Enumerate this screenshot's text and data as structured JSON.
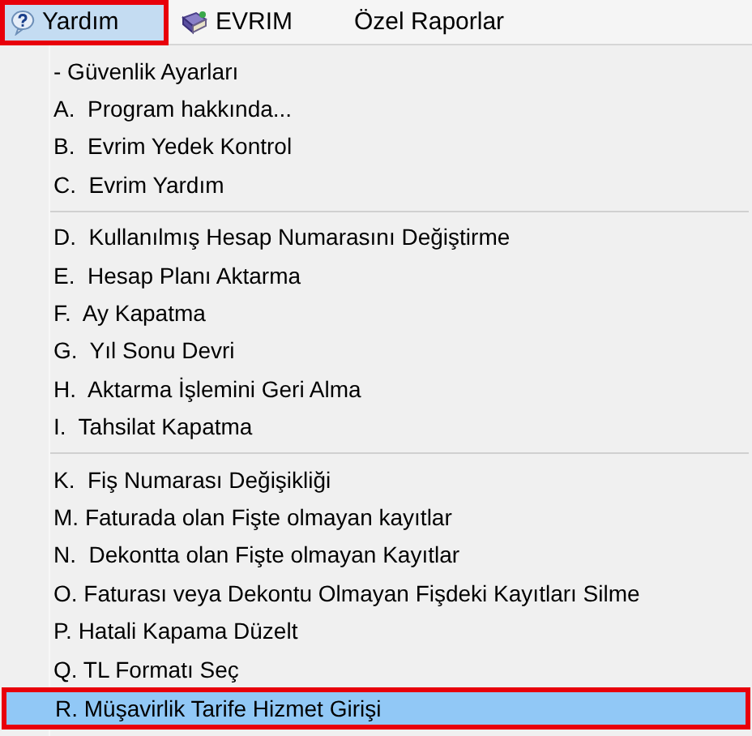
{
  "menu_bar": [
    {
      "label": "Yardım",
      "kind": "help",
      "selected": true
    },
    {
      "label": "EVRIM",
      "kind": "book",
      "selected": false
    },
    {
      "label": "Özel Raporlar",
      "kind": "text",
      "selected": false
    }
  ],
  "menu": {
    "groups": [
      [
        {
          "label": "- Güvenlik Ayarları",
          "selected": false
        },
        {
          "label": "A.  Program hakkında...",
          "selected": false
        },
        {
          "label": "B.  Evrim Yedek Kontrol",
          "selected": false
        },
        {
          "label": "C.  Evrim Yardım",
          "selected": false
        }
      ],
      [
        {
          "label": "D.  Kullanılmış Hesap Numarasını Değiştirme",
          "selected": false
        },
        {
          "label": "E.  Hesap Planı Aktarma",
          "selected": false
        },
        {
          "label": "F.  Ay Kapatma",
          "selected": false
        },
        {
          "label": "G.  Yıl Sonu Devri",
          "selected": false
        },
        {
          "label": "H.  Aktarma İşlemini Geri Alma",
          "selected": false
        },
        {
          "label": "I.  Tahsilat Kapatma",
          "selected": false
        }
      ],
      [
        {
          "label": "K.  Fiş Numarası Değişikliği",
          "selected": false
        },
        {
          "label": "M. Faturada olan Fişte olmayan kayıtlar",
          "selected": false
        },
        {
          "label": "N.  Dekontta olan Fişte olmayan Kayıtlar",
          "selected": false
        },
        {
          "label": "O. Faturası veya Dekontu Olmayan Fişdeki Kayıtları Silme",
          "selected": false
        },
        {
          "label": "P. Hatali Kapama Düzelt",
          "selected": false
        },
        {
          "label": "Q. TL Formatı Seç",
          "selected": false
        },
        {
          "label": "R. Müşavirlik Tarife Hizmet Girişi",
          "selected": true
        }
      ]
    ]
  }
}
